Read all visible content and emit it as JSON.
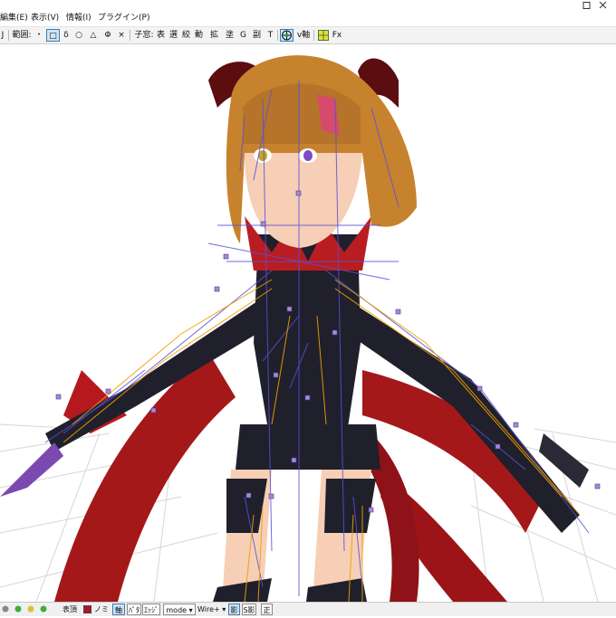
{
  "menubar": {
    "items": [
      {
        "label": "編集(E)"
      },
      {
        "label": "表示(V)"
      },
      {
        "label": "情報(I)"
      },
      {
        "label": "プラグイン(P)"
      }
    ]
  },
  "toolbar": {
    "partial_left": "J",
    "range_label": "範囲:",
    "dot": "・",
    "square_select": "□",
    "lasso": "δ",
    "circle": "○",
    "triangle": "△",
    "phi": "Φ",
    "close": "×",
    "gizmo_label": "子窓:",
    "buttons": [
      "表",
      "選",
      "絞",
      "動",
      "拡",
      "塗",
      "G",
      "副",
      "T"
    ],
    "axis_label": "v軸",
    "fx_label": "Fx"
  },
  "statusbar": {
    "visible_toggle": "表頂",
    "face_label": "ノミ",
    "axis_btn": "軸",
    "pattern_btn": "ﾊﾟﾀ",
    "edge_btn": "ｴｯｼﾞ",
    "mode_label": "mode",
    "wire_label": "Wire+",
    "shadow_btn": "影",
    "s_shadow": "S影",
    "ortho_btn": "正"
  },
  "colors": {
    "accent": "#0a64c8",
    "toolbar_bg": "#f3f3f3",
    "selected_bg": "#cce4f7",
    "bone_blue": "#5a50d8",
    "bone_orange": "#f0a000",
    "grid": "#d6d6d6",
    "costume_black": "#20202c",
    "wing_red": "#a5181a",
    "hair": "#c7822e",
    "skin": "#f6cfb6"
  },
  "icons": {
    "window_close": "close-icon",
    "window_maximize": "maximize-icon",
    "select_rect": "rectangle-select-icon",
    "axis": "axis-globe-icon",
    "material": "material-grid-icon"
  }
}
